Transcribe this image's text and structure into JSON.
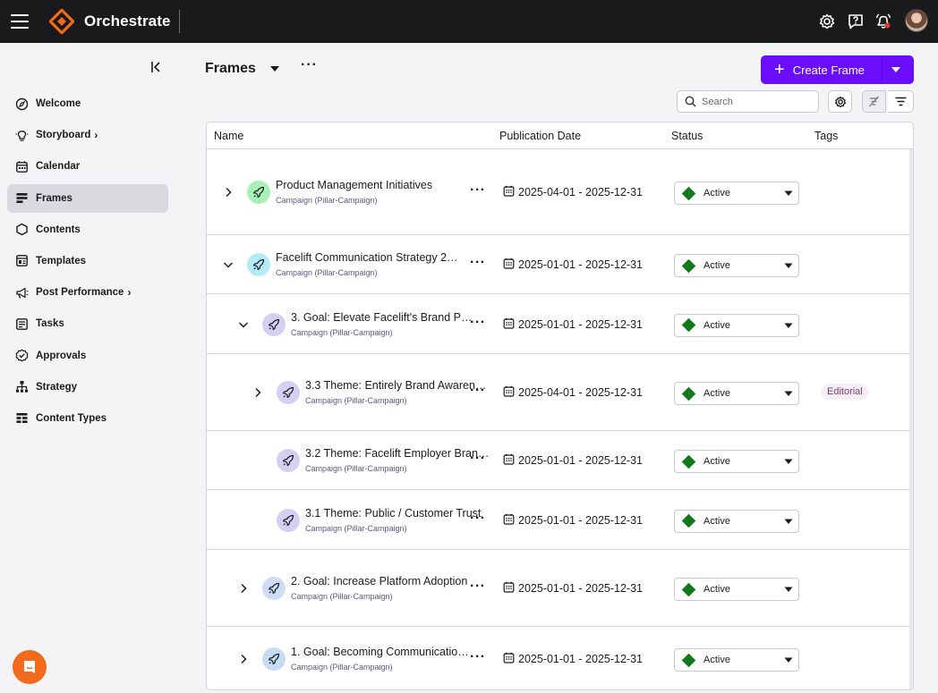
{
  "app": {
    "name": "Orchestrate",
    "icons": {
      "menu": "hamburger-icon",
      "settings": "gear-icon",
      "help": "help-icon",
      "notifications": "bell-icon",
      "avatar": "user-avatar"
    },
    "accent_color": "#6a0dfa",
    "brand_color": "#f26a1b"
  },
  "sidebar": {
    "items": [
      {
        "label": "Welcome",
        "icon": "compass-icon",
        "active": false
      },
      {
        "label": "Storyboard",
        "icon": "lightbulb-icon",
        "active": false,
        "has_submenu": true
      },
      {
        "label": "Calendar",
        "icon": "calendar-icon",
        "active": false
      },
      {
        "label": "Frames",
        "icon": "frames-icon",
        "active": true
      },
      {
        "label": "Contents",
        "icon": "hexagon-icon",
        "active": false
      },
      {
        "label": "Templates",
        "icon": "templates-icon",
        "active": false
      },
      {
        "label": "Post Performance",
        "icon": "megaphone-icon",
        "active": false,
        "has_submenu": true
      },
      {
        "label": "Tasks",
        "icon": "tasks-icon",
        "active": false
      },
      {
        "label": "Approvals",
        "icon": "check-circle-icon",
        "active": false
      },
      {
        "label": "Strategy",
        "icon": "hierarchy-icon",
        "active": false
      },
      {
        "label": "Content Types",
        "icon": "content-types-icon",
        "active": false
      }
    ]
  },
  "header": {
    "title": "Frames",
    "create_button": "Create Frame",
    "search_placeholder": "Search"
  },
  "table": {
    "columns": [
      "Name",
      "Publication Date",
      "Status",
      "Tags"
    ],
    "rows": [
      {
        "name": "Product Management Initiatives",
        "type": "Campaign (Pillar-Campaign)",
        "date": "2025-04-01 - 2025-12-31",
        "status": "Active",
        "tag": "",
        "expanded": false,
        "level": 0,
        "icon_color": "#a8f0b6"
      },
      {
        "name": "Facelift Communication Strategy 2…",
        "type": "Campaign (Pillar-Campaign)",
        "date": "2025-01-01 - 2025-12-31",
        "status": "Active",
        "tag": "",
        "expanded": true,
        "level": 0,
        "icon_color": "#b3ecf7"
      },
      {
        "name": "3. Goal: Elevate Facelift's Brand P…",
        "type": "Campaign (Pillar-Campaign)",
        "date": "2025-01-01 - 2025-12-31",
        "status": "Active",
        "tag": "",
        "expanded": true,
        "level": 1,
        "icon_color": "#d4d0f4"
      },
      {
        "name": "3.3 Theme: Entirely Brand Awaren…",
        "type": "Campaign (Pillar-Campaign)",
        "date": "2025-04-01 - 2025-12-31",
        "status": "Active",
        "tag": "Editorial",
        "expanded": false,
        "level": 2,
        "icon_color": "#d4d0f4"
      },
      {
        "name": "3.2 Theme: Facelift Employer Bran…",
        "type": "Campaign (Pillar-Campaign)",
        "date": "2025-01-01 - 2025-12-31",
        "status": "Active",
        "tag": "",
        "expanded": null,
        "level": 2,
        "icon_color": "#d4d0f4"
      },
      {
        "name": "3.1 Theme: Public / Customer Trust",
        "type": "Campaign (Pillar-Campaign)",
        "date": "2025-01-01 - 2025-12-31",
        "status": "Active",
        "tag": "",
        "expanded": null,
        "level": 2,
        "icon_color": "#d4d0f4"
      },
      {
        "name": "2. Goal: Increase Platform Adoption",
        "type": "Campaign (Pillar-Campaign)",
        "date": "2025-01-01 - 2025-12-31",
        "status": "Active",
        "tag": "",
        "expanded": false,
        "level": 1,
        "icon_color": "#cddcf7"
      },
      {
        "name": "1. Goal: Becoming Communication…",
        "type": "Campaign (Pillar-Campaign)",
        "date": "2025-01-01 - 2025-12-31",
        "status": "Active",
        "tag": "",
        "expanded": false,
        "level": 1,
        "icon_color": "#c6dcf5"
      }
    ],
    "status_color": "#127a1c"
  }
}
